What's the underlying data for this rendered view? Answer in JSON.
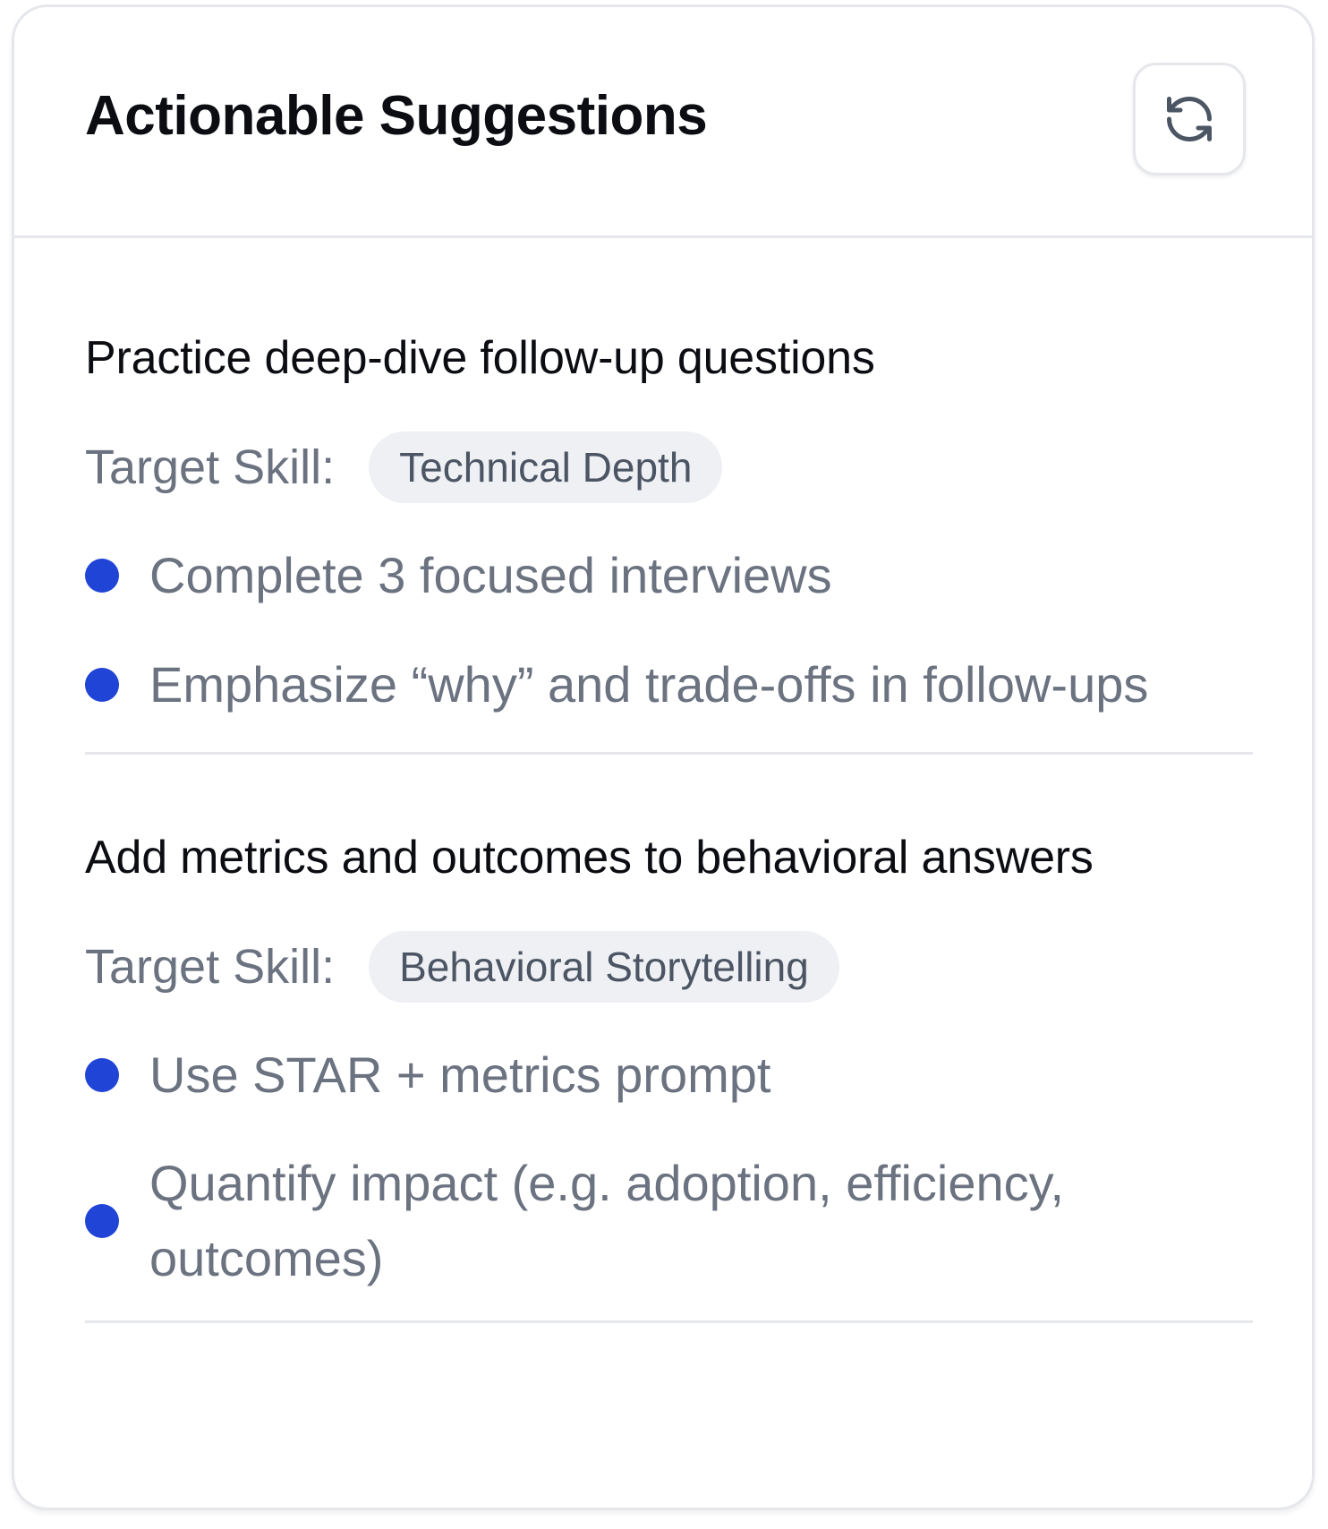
{
  "card": {
    "title": "Actionable Suggestions",
    "refresh_icon": "refresh-icon"
  },
  "suggestions": [
    {
      "title": "Practice deep-dive follow-up questions",
      "target_skill_label": "Target Skill:",
      "target_skill": "Technical Depth",
      "bullets": [
        "Complete 3 focused interviews",
        "Emphasize “why” and trade-offs in follow-ups"
      ]
    },
    {
      "title": "Add metrics and outcomes to behavioral answers",
      "target_skill_label": "Target Skill:",
      "target_skill": "Behavioral Storytelling",
      "bullets": [
        "Use STAR + metrics prompt",
        "Quantify impact (e.g. adoption, efficiency, outcomes)"
      ]
    }
  ],
  "colors": {
    "accent_dot": "#1f44d6",
    "muted_text": "#6b7280",
    "border": "#e5e7eb",
    "chip_bg": "#eef0f3"
  }
}
